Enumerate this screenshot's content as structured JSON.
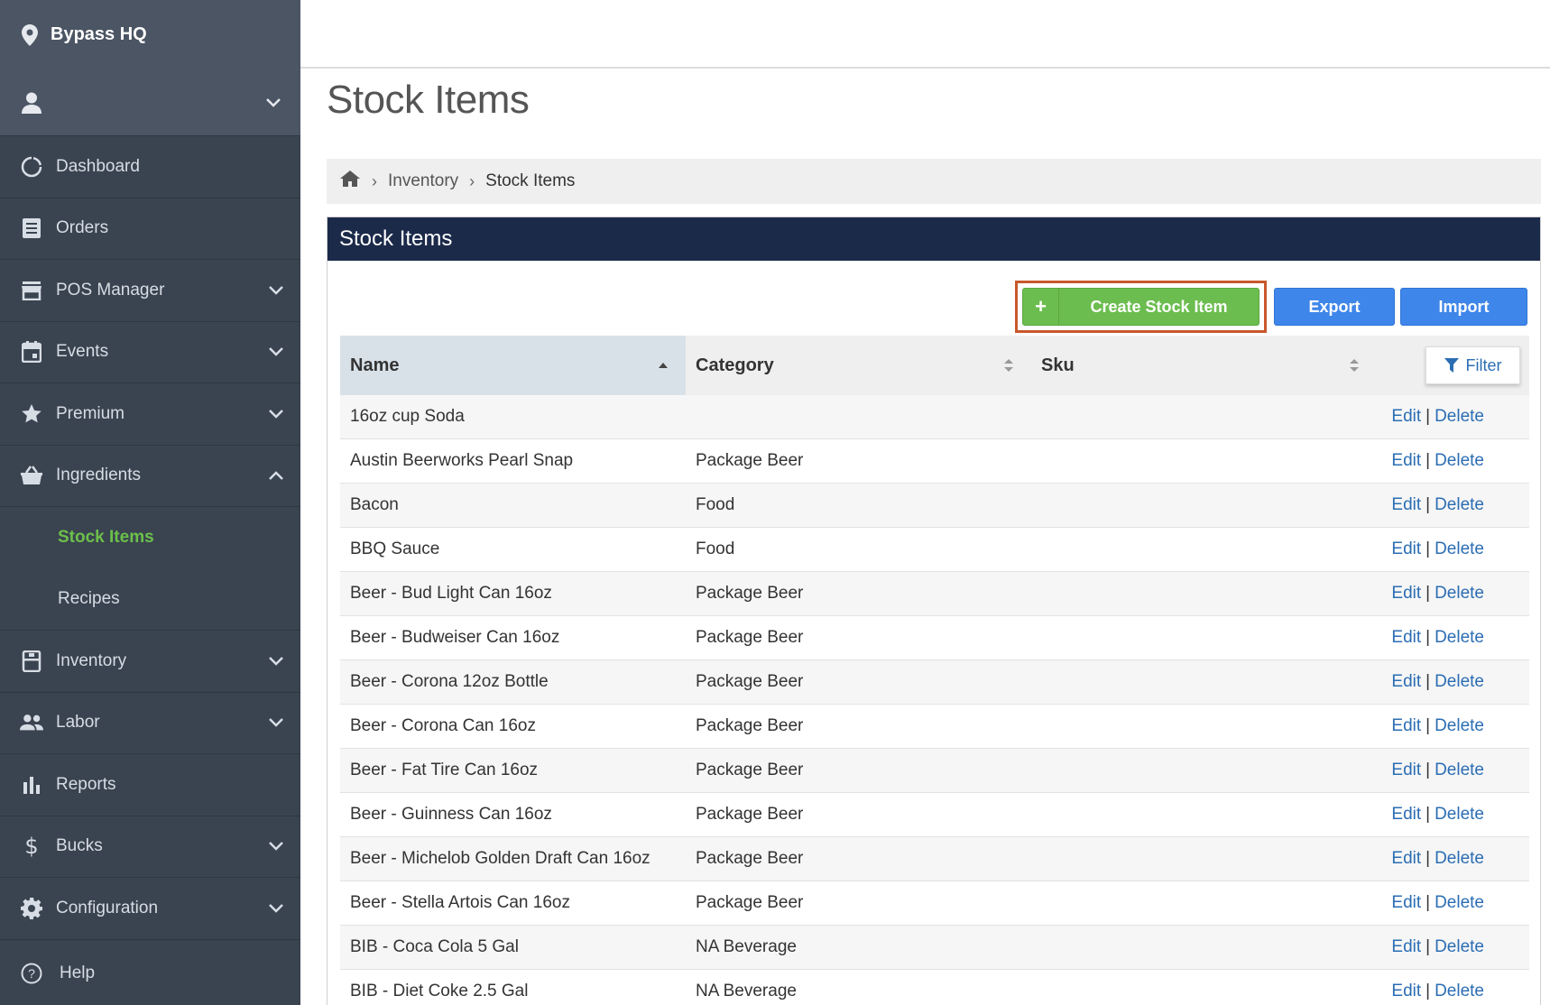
{
  "sidebar": {
    "location": "Bypass HQ",
    "items": [
      {
        "label": "Dashboard",
        "icon": "dashboard-icon",
        "has_chevron": false
      },
      {
        "label": "Orders",
        "icon": "orders-icon",
        "has_chevron": false
      },
      {
        "label": "POS Manager",
        "icon": "store-icon",
        "has_chevron": true
      },
      {
        "label": "Events",
        "icon": "calendar-icon",
        "has_chevron": true
      },
      {
        "label": "Premium",
        "icon": "star-icon",
        "has_chevron": true
      },
      {
        "label": "Ingredients",
        "icon": "basket-icon",
        "has_chevron": true,
        "expanded": true
      },
      {
        "label": "Inventory",
        "icon": "inventory-icon",
        "has_chevron": true
      },
      {
        "label": "Labor",
        "icon": "people-icon",
        "has_chevron": true
      },
      {
        "label": "Reports",
        "icon": "bar-chart-icon",
        "has_chevron": false
      },
      {
        "label": "Bucks",
        "icon": "dollar-icon",
        "has_chevron": true
      },
      {
        "label": "Configuration",
        "icon": "gear-icon",
        "has_chevron": true
      },
      {
        "label": "Help",
        "icon": "help-icon",
        "has_chevron": false
      }
    ],
    "subitems": [
      {
        "label": "Stock Items",
        "active": true
      },
      {
        "label": "Recipes",
        "active": false
      }
    ],
    "active_color": "#6cc04a"
  },
  "page": {
    "title": "Stock Items"
  },
  "breadcrumb": {
    "items": [
      "Inventory",
      "Stock Items"
    ]
  },
  "panel": {
    "title": "Stock Items",
    "create_label": "Create Stock Item",
    "create_plus": "+",
    "export_label": "Export",
    "import_label": "Import"
  },
  "table": {
    "columns": [
      "Name",
      "Category",
      "Sku"
    ],
    "filter_label": "Filter",
    "edit_label": "Edit",
    "delete_label": "Delete",
    "separator": "|",
    "rows": [
      {
        "name": "16oz cup Soda",
        "category": "",
        "sku": ""
      },
      {
        "name": "Austin Beerworks Pearl Snap",
        "category": "Package Beer",
        "sku": ""
      },
      {
        "name": "Bacon",
        "category": "Food",
        "sku": ""
      },
      {
        "name": "BBQ Sauce",
        "category": "Food",
        "sku": ""
      },
      {
        "name": "Beer - Bud Light Can 16oz",
        "category": "Package Beer",
        "sku": ""
      },
      {
        "name": "Beer - Budweiser Can 16oz",
        "category": "Package Beer",
        "sku": ""
      },
      {
        "name": "Beer - Corona 12oz Bottle",
        "category": "Package Beer",
        "sku": ""
      },
      {
        "name": "Beer - Corona Can 16oz",
        "category": "Package Beer",
        "sku": ""
      },
      {
        "name": "Beer - Fat Tire Can 16oz",
        "category": "Package Beer",
        "sku": ""
      },
      {
        "name": "Beer - Guinness Can 16oz",
        "category": "Package Beer",
        "sku": ""
      },
      {
        "name": "Beer - Michelob Golden Draft Can 16oz",
        "category": "Package Beer",
        "sku": ""
      },
      {
        "name": "Beer - Stella Artois Can 16oz",
        "category": "Package Beer",
        "sku": ""
      },
      {
        "name": "BIB - Coca Cola 5 Gal",
        "category": "NA Beverage",
        "sku": ""
      },
      {
        "name": "BIB - Diet Coke 2.5 Gal",
        "category": "NA Beverage",
        "sku": ""
      }
    ]
  },
  "colors": {
    "sidebar_bg": "#3a4350",
    "panel_header": "#1c2a4a",
    "create_green": "#6cbd4f",
    "action_blue": "#3f86ea",
    "link_blue": "#2b6db3",
    "highlight_border": "#c8582b"
  }
}
